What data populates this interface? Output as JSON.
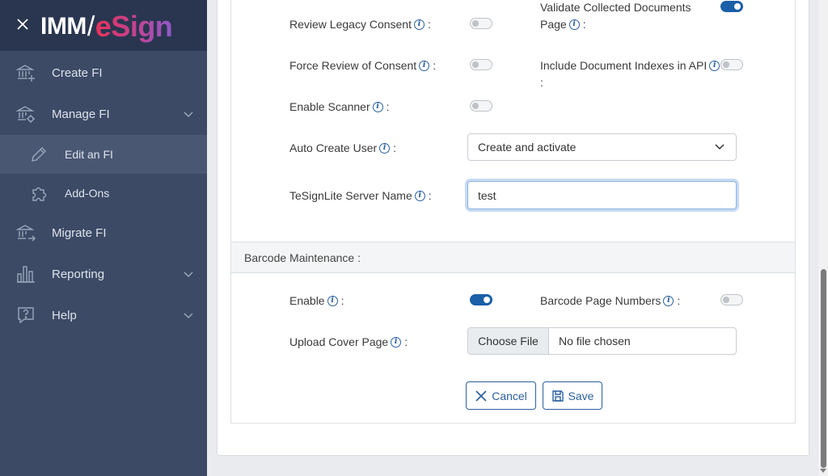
{
  "sidebar": {
    "logo_imm": "IMM",
    "logo_esign": "eSign",
    "items": [
      {
        "label": "Create FI"
      },
      {
        "label": "Manage FI"
      },
      {
        "label": "Edit an FI"
      },
      {
        "label": "Add-Ons"
      },
      {
        "label": "Migrate FI"
      },
      {
        "label": "Reporting"
      },
      {
        "label": "Help"
      }
    ]
  },
  "form": {
    "review_legacy_consent": {
      "label": "Review Legacy Consent",
      "enabled": false
    },
    "validate_collected_documents": {
      "label_line1": "Validate Collected Documents",
      "label_line2": "Page",
      "enabled": true
    },
    "force_review_consent": {
      "label": "Force Review of Consent",
      "enabled": false
    },
    "include_document_indexes": {
      "label": "Include Document Indexes in API",
      "enabled": false
    },
    "enable_scanner": {
      "label": "Enable Scanner",
      "enabled": false
    },
    "auto_create_user": {
      "label": "Auto Create User",
      "value": "Create and activate"
    },
    "tesignlite_server_name": {
      "label": "TeSignLite Server Name",
      "value": "test"
    },
    "colon": ":"
  },
  "barcode": {
    "section_title": "Barcode Maintenance :",
    "enable": {
      "label": "Enable",
      "enabled": true
    },
    "page_numbers": {
      "label": "Barcode Page Numbers",
      "enabled": false
    },
    "upload_cover_page": {
      "label": "Upload Cover Page",
      "button": "Choose File",
      "status": "No file chosen"
    }
  },
  "actions": {
    "cancel": "Cancel",
    "save": "Save"
  },
  "colors": {
    "sidebar_bg": "#3c4a66",
    "accent": "#1b5fa8"
  }
}
